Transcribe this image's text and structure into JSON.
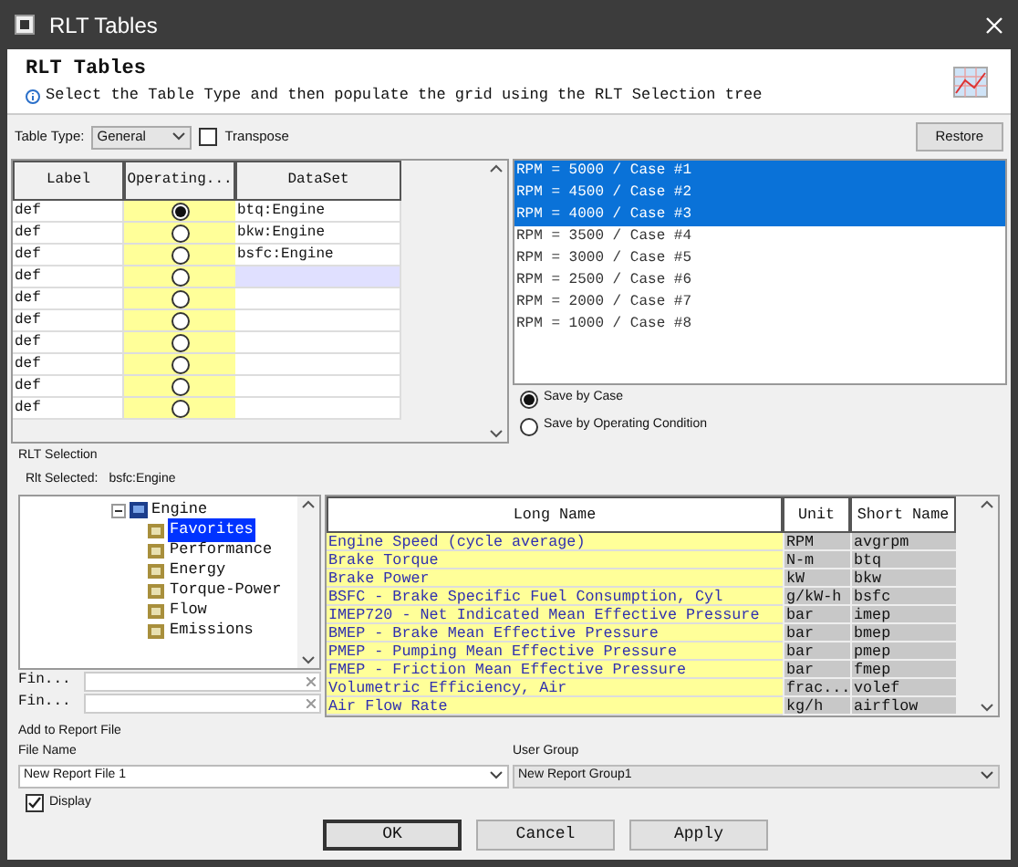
{
  "window": {
    "title": "RLT Tables"
  },
  "header": {
    "title": "RLT Tables",
    "subtitle": "Select the Table Type and then populate the grid using the RLT Selection tree"
  },
  "toolbar": {
    "table_type_label": "Table Type:",
    "table_type": "General",
    "transpose": {
      "label": "Transpose",
      "checked": false
    },
    "restore": "Restore"
  },
  "grid": {
    "columns": [
      "Label",
      "Operating...",
      "DataSet"
    ],
    "rows": [
      {
        "label": "def",
        "selected": true,
        "dataset": "btq:Engine",
        "highlighted": false
      },
      {
        "label": "def",
        "selected": false,
        "dataset": "bkw:Engine",
        "highlighted": false
      },
      {
        "label": "def",
        "selected": false,
        "dataset": "bsfc:Engine",
        "highlighted": false
      },
      {
        "label": "def",
        "selected": false,
        "dataset": "",
        "highlighted": true
      },
      {
        "label": "def",
        "selected": false,
        "dataset": "",
        "highlighted": false
      },
      {
        "label": "def",
        "selected": false,
        "dataset": "",
        "highlighted": false
      },
      {
        "label": "def",
        "selected": false,
        "dataset": "",
        "highlighted": false
      },
      {
        "label": "def",
        "selected": false,
        "dataset": "",
        "highlighted": false
      },
      {
        "label": "def",
        "selected": false,
        "dataset": "",
        "highlighted": false
      },
      {
        "label": "def",
        "selected": false,
        "dataset": "",
        "highlighted": false
      }
    ]
  },
  "cases": [
    {
      "label": "RPM = 5000 / Case #1",
      "selected": true
    },
    {
      "label": "RPM = 4500 / Case #2",
      "selected": true
    },
    {
      "label": "RPM = 4000 / Case #3",
      "selected": true
    },
    {
      "label": "RPM = 3500 / Case #4",
      "selected": false
    },
    {
      "label": "RPM = 3000 / Case #5",
      "selected": false
    },
    {
      "label": "RPM = 2500 / Case #6",
      "selected": false
    },
    {
      "label": "RPM = 2000 / Case #7",
      "selected": false
    },
    {
      "label": "RPM = 1000 / Case #8",
      "selected": false
    }
  ],
  "save_options": [
    {
      "label": "Save by Case",
      "selected": true
    },
    {
      "label": "Save by Operating Condition",
      "selected": false
    }
  ],
  "rlt_selection": {
    "title": "RLT Selection",
    "selected_label": "Rlt Selected:",
    "selected_value": "bsfc:Engine",
    "tree": [
      {
        "label": "Engine",
        "expanded": true,
        "selected": false,
        "children": [
          {
            "label": "Favorites",
            "selected": true
          },
          {
            "label": "Performance",
            "selected": false
          },
          {
            "label": "Energy",
            "selected": false
          },
          {
            "label": "Torque-Power",
            "selected": false
          },
          {
            "label": "Flow",
            "selected": false
          },
          {
            "label": "Emissions",
            "selected": false
          }
        ]
      }
    ],
    "finders": [
      {
        "label": "Fin..."
      },
      {
        "label": "Fin..."
      }
    ],
    "columns": [
      "Long Name",
      "Unit",
      "Short Name"
    ],
    "rows": [
      {
        "long": "Engine Speed (cycle average)",
        "unit": "RPM",
        "short": "avgrpm"
      },
      {
        "long": "Brake Torque",
        "unit": "N-m",
        "short": "btq"
      },
      {
        "long": "Brake Power",
        "unit": "kW",
        "short": "bkw"
      },
      {
        "long": "BSFC - Brake Specific Fuel Consumption, Cyl",
        "unit": "g/kW-h",
        "short": "bsfc"
      },
      {
        "long": "IMEP720 - Net Indicated Mean Effective Pressure",
        "unit": "bar",
        "short": "imep"
      },
      {
        "long": "BMEP - Brake Mean Effective Pressure",
        "unit": "bar",
        "short": "bmep"
      },
      {
        "long": "PMEP - Pumping Mean Effective Pressure",
        "unit": "bar",
        "short": "pmep"
      },
      {
        "long": "FMEP - Friction Mean Effective Pressure",
        "unit": "bar",
        "short": "fmep"
      },
      {
        "long": "Volumetric Efficiency, Air",
        "unit": "frac...",
        "short": "volef"
      },
      {
        "long": "Air Flow Rate",
        "unit": "kg/h",
        "short": "airflow"
      }
    ]
  },
  "report": {
    "title": "Add to Report File",
    "file_name_label": "File Name",
    "file_name": "New Report File 1",
    "user_group_label": "User Group",
    "user_group": "New Report Group1",
    "display": {
      "label": "Display",
      "checked": true
    }
  },
  "buttons": [
    "OK",
    "Cancel",
    "Apply"
  ]
}
